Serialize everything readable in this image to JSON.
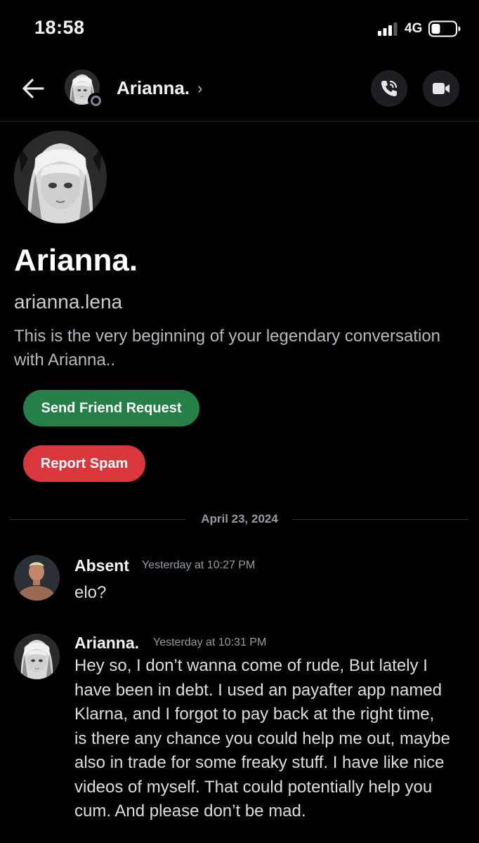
{
  "status_bar": {
    "time": "18:58",
    "network": "4G"
  },
  "header": {
    "name": "Arianna.",
    "chevron": "›",
    "icons": [
      "back-arrow-icon",
      "phone-call-icon",
      "video-camera-icon"
    ]
  },
  "profile": {
    "display_name": "Arianna.",
    "username": "arianna.lena",
    "intro": "This is the very beginning of your legendary conversation with Arianna..",
    "friend_button": "Send Friend Request",
    "spam_button": "Report Spam"
  },
  "date_divider": "April 23, 2024",
  "messages": [
    {
      "author": "Absent",
      "time": "Yesterday at 10:27 PM",
      "lines": [
        "elo?"
      ]
    },
    {
      "author": "Arianna.",
      "time": "Yesterday at 10:31 PM",
      "lines": [
        "Hey so, I don’t wanna come of rude, But lately I",
        "have been in debt. I used an payafter app named",
        "Klarna, and I forgot to pay back at the right time,",
        "is there any chance you could help me out, maybe",
        "also in trade for some freaky stuff. I have like nice",
        "videos of myself. That could potentially help you",
        "cum. And please don’t be mad."
      ]
    }
  ],
  "colors": {
    "background": "#000000",
    "friend_button": "#248046",
    "spam_button": "#da373c",
    "muted_text": "#949ba4"
  }
}
